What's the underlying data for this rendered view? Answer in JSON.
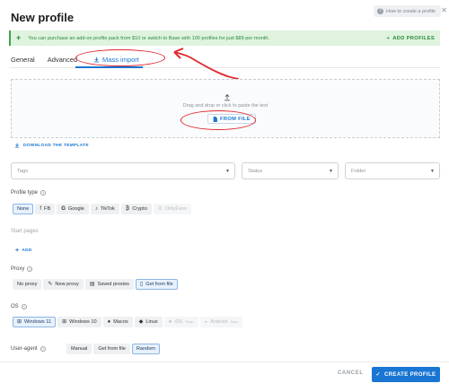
{
  "header": {
    "title": "New profile",
    "help_label": "How to create a profile",
    "help_icon": "question-icon",
    "close_icon": "close-icon"
  },
  "banner": {
    "text": "You can purchase an add-on profile pack from $10 or switch to Base with 100 profiles for just $89 per month.",
    "action_label": "ADD PROFILES",
    "color": "#3aa54a"
  },
  "tabs": [
    {
      "label": "General"
    },
    {
      "label": "Advanced"
    },
    {
      "label": "Mass import",
      "active": true,
      "icon": "download-icon"
    }
  ],
  "dropzone": {
    "hint": "Drag and drop or click to paste the text",
    "button_label": "FROM FILE",
    "upload_icon": "upload-icon"
  },
  "template_link": "DOWNLOAD THE TEMPLATE",
  "selects": {
    "tags_placeholder": "Tags",
    "status_placeholder": "Status",
    "folder_placeholder": "Folder"
  },
  "profile_type": {
    "label": "Profile type",
    "options": [
      "None",
      "FB",
      "Google",
      "TikTok",
      "Crypto",
      "OnlyFans"
    ],
    "selected": "None"
  },
  "start_pages": {
    "label": "Start pages",
    "add_label": "ADD"
  },
  "proxy": {
    "label": "Proxy",
    "options": [
      "No proxy",
      "New proxy",
      "Saved proxies",
      "Get from file"
    ],
    "selected": "Get from file"
  },
  "os": {
    "label": "OS",
    "options": [
      "Windows 11",
      "Windows 10",
      "Macos",
      "Linux",
      "iOS",
      "Android"
    ],
    "soon_label": "Soon",
    "selected": "Windows 11"
  },
  "user_agent": {
    "label": "User-agent",
    "options": [
      "Manual",
      "Get from file",
      "Random"
    ],
    "selected": "Random"
  },
  "footer": {
    "cancel_label": "CANCEL",
    "create_label": "CREATE PROFILE"
  },
  "colors": {
    "accent": "#1976d2",
    "annotation": "#e0262d"
  }
}
